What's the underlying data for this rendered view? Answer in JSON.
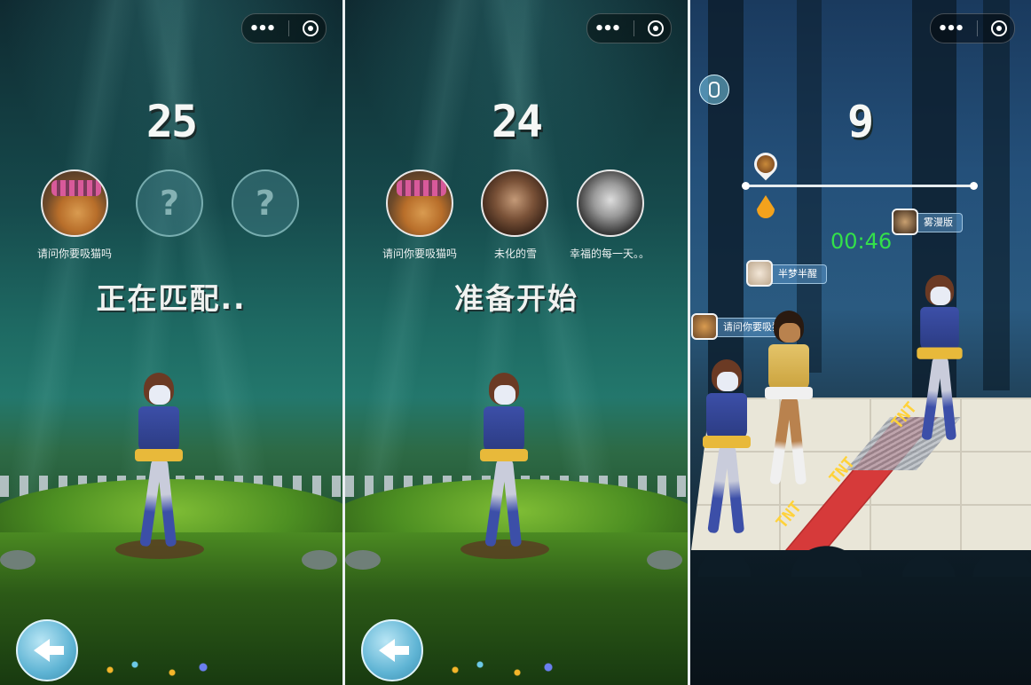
{
  "panels": [
    {
      "countdown": "25",
      "status": "正在匹配..",
      "players": [
        {
          "name": "请问你要吸猫吗",
          "avatar": "cat-photo",
          "filled": true
        },
        {
          "name": "",
          "avatar": "question-mark",
          "filled": false,
          "placeholder": "?"
        },
        {
          "name": "",
          "avatar": "question-mark",
          "filled": false,
          "placeholder": "?"
        }
      ]
    },
    {
      "countdown": "24",
      "status": "准备开始",
      "players": [
        {
          "name": "请问你要吸猫吗",
          "avatar": "cat-photo",
          "filled": true
        },
        {
          "name": "未化的雪",
          "avatar": "man-portrait",
          "filled": true
        },
        {
          "name": "幸福的每一天。。",
          "avatar": "man-portrait-bw",
          "filled": true
        }
      ]
    },
    {
      "countdown": "9",
      "timer": "00:46",
      "progress": {
        "start": 0.0,
        "end": 1.0,
        "markers": [
          "player-pin",
          "drop-marker"
        ]
      },
      "player_tags": [
        {
          "name": "雾漫版",
          "avatar": "man-portrait"
        },
        {
          "name": "半梦半醒",
          "avatar": "cartoon-face"
        },
        {
          "name": "请问你要吸猫吗",
          "avatar": "cat-photo"
        }
      ],
      "hazard_label": "TNT"
    }
  ],
  "capsule": {
    "more_icon": "more-dots-icon",
    "close_icon": "target-close-icon"
  },
  "icons": {
    "back": "back-arrow-icon",
    "mic": "microphone-icon"
  },
  "colors": {
    "timer": "#33e04a",
    "tnt": "#d63a3a",
    "tnt_text": "#ffd23a"
  }
}
